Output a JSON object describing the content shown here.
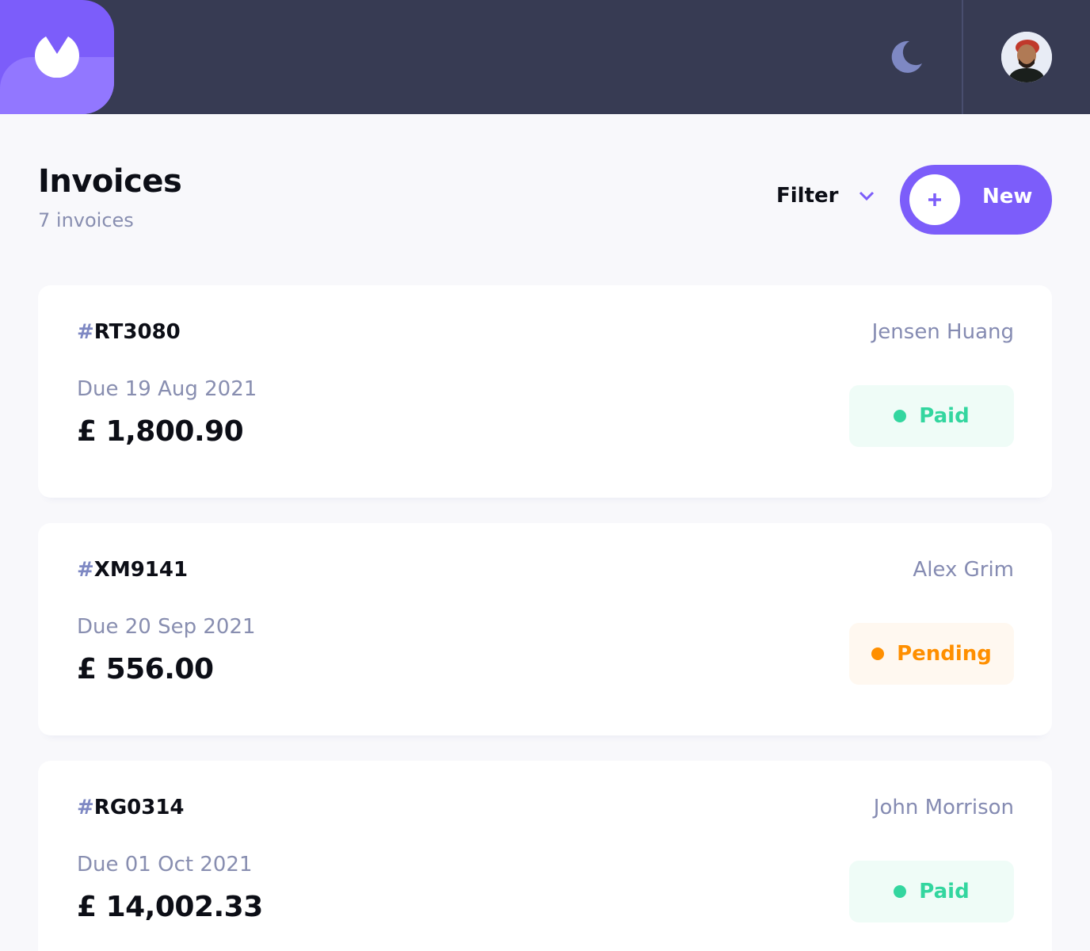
{
  "header": {
    "logo_icon": "app-logo-icon",
    "theme_toggle_icon": "moon-icon",
    "avatar": "user-avatar"
  },
  "page": {
    "title": "Invoices",
    "subtitle": "7 invoices",
    "filter_label": "Filter",
    "new_button_label": "New"
  },
  "invoices": [
    {
      "hash": "#",
      "id": "RT3080",
      "client": "Jensen Huang",
      "due": "Due 19 Aug 2021",
      "amount": "£ 1,800.90",
      "status": "Paid"
    },
    {
      "hash": "#",
      "id": "XM9141",
      "client": "Alex Grim",
      "due": "Due 20 Sep 2021",
      "amount": "£ 556.00",
      "status": "Pending"
    },
    {
      "hash": "#",
      "id": "RG0314",
      "client": "John Morrison",
      "due": "Due 01 Oct 2021",
      "amount": "£ 14,002.33",
      "status": "Paid"
    }
  ],
  "colors": {
    "accent": "#7c5dfa",
    "accent_light": "#9277ff",
    "header_bg": "#373b53",
    "paid": "#33d69f",
    "pending": "#ff8f00"
  }
}
